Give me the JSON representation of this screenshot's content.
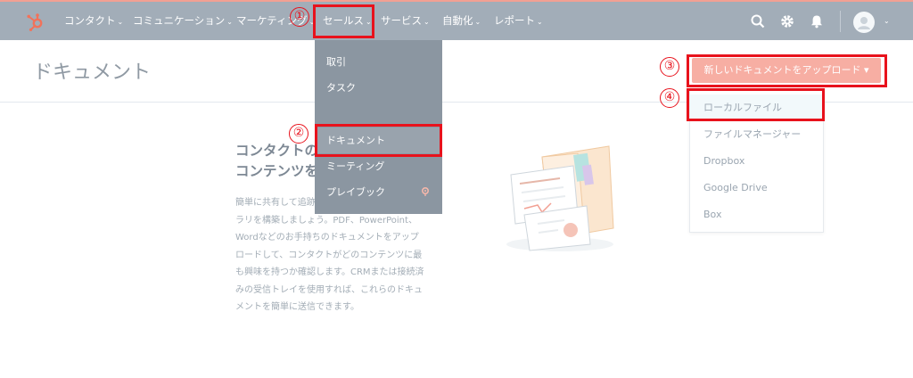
{
  "nav": {
    "items": [
      {
        "label": "コンタクト"
      },
      {
        "label": "コミュニケーション"
      },
      {
        "label": "マーケティング"
      },
      {
        "label": "セールス"
      },
      {
        "label": "サービス"
      },
      {
        "label": "自動化"
      },
      {
        "label": "レポート"
      }
    ],
    "chevron": "⌄"
  },
  "sales_menu": {
    "items": [
      {
        "label": "取引"
      },
      {
        "label": "タスク"
      },
      {
        "label": "ドキュメント"
      },
      {
        "label": "ミーティング"
      },
      {
        "label": "プレイブック"
      }
    ]
  },
  "page": {
    "title": "ドキュメント"
  },
  "upload": {
    "button_label": "新しいドキュメントをアップロード ▾",
    "options": [
      {
        "label": "ローカルファイル"
      },
      {
        "label": "ファイルマネージャー"
      },
      {
        "label": "Dropbox"
      },
      {
        "label": "Google Drive"
      },
      {
        "label": "Box"
      }
    ]
  },
  "content": {
    "title_line1": "コンタクトの",
    "title_line2": "コンテンツを",
    "body_lines": [
      "簡単に共有して追跡",
      "ラリを構築しましょう。PDF、PowerPoint、",
      "Wordなどのお手持ちのドキュメントをアップ",
      "ロードして、コンタクトがどのコンテンツに最",
      "も興味を持つか確認します。CRMまたは接続済",
      "みの受信トレイを使用すれば、これらのドキュ",
      "メントを簡単に送信できます。"
    ]
  },
  "annotations": [
    "①",
    "②",
    "③",
    "④"
  ],
  "colors": {
    "navbar": "#a2adb8",
    "menu": "#8b96a1",
    "accent": "#f7aea3",
    "annotation": "#e8121c"
  }
}
